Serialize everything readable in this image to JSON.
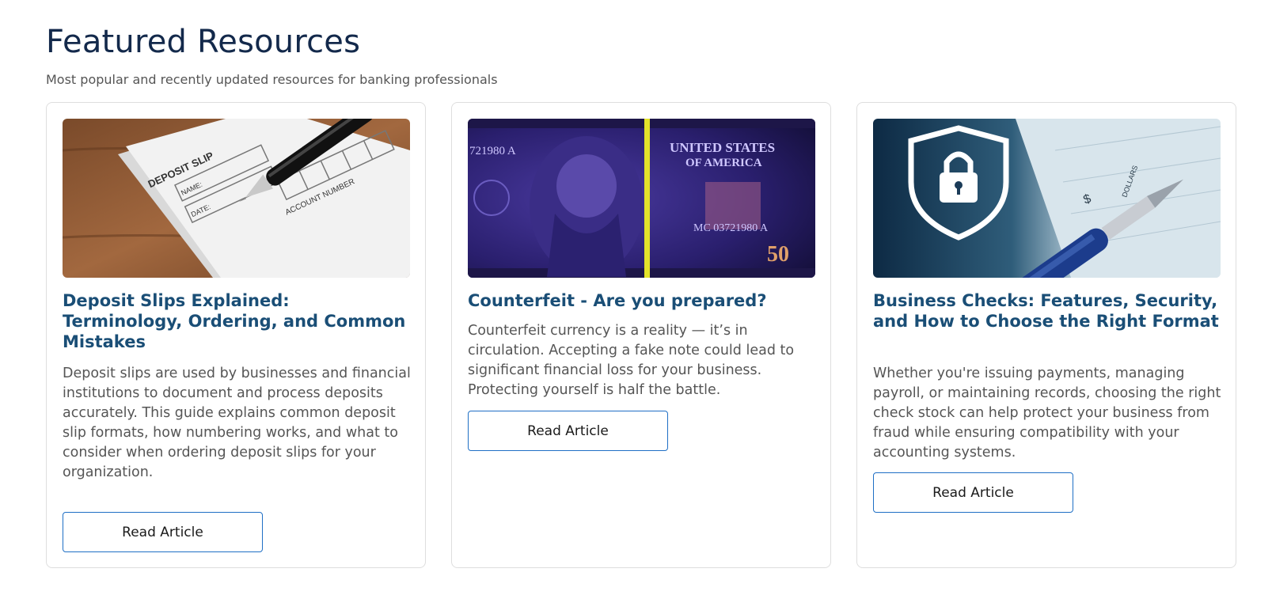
{
  "section": {
    "title": "Featured Resources",
    "subtitle": "Most popular and recently updated resources for banking professionals"
  },
  "cards": [
    {
      "image": "deposit-slip-photo",
      "image_text": [
        "DEPOSIT SLIP",
        "NAME:",
        "DATE:",
        "ACCOUNT NUMBER"
      ],
      "title": "Deposit Slips Explained: Terminology, Ordering, and Common Mistakes",
      "description": "Deposit slips are used by businesses and financial institutions to document and process deposits accurately. This guide explains common deposit slip formats, how numbering works, and what to consider when ordering deposit slips for your organization.",
      "button": "Read Article"
    },
    {
      "image": "counterfeit-50-dollar-uv-photo",
      "image_text": [
        "721980 A",
        "UNITED STATES",
        "OF AMERICA",
        "MC 03721980 A",
        "50"
      ],
      "title": "Counterfeit - Are you prepared?",
      "description": "Counterfeit currency is a reality — it’s in circulation. Accepting a fake note could lead to significant financial loss for your business. Protecting yourself is half the battle.",
      "button": "Read Article"
    },
    {
      "image": "security-shield-check-pen-photo",
      "image_text": [
        "$",
        "DOLLARS"
      ],
      "title": "Business Checks: Features, Security, and How to Choose the Right Format",
      "description": "Whether you're issuing payments, managing payroll, or maintaining records, choosing the right check stock can help protect your business from fraud while ensuring compatibility with your accounting systems.",
      "button": "Read Article"
    }
  ],
  "colors": {
    "heading": "#13294b",
    "card_title": "#1a4e76",
    "button_border": "#1f6fc5",
    "card_border": "#dedede"
  }
}
